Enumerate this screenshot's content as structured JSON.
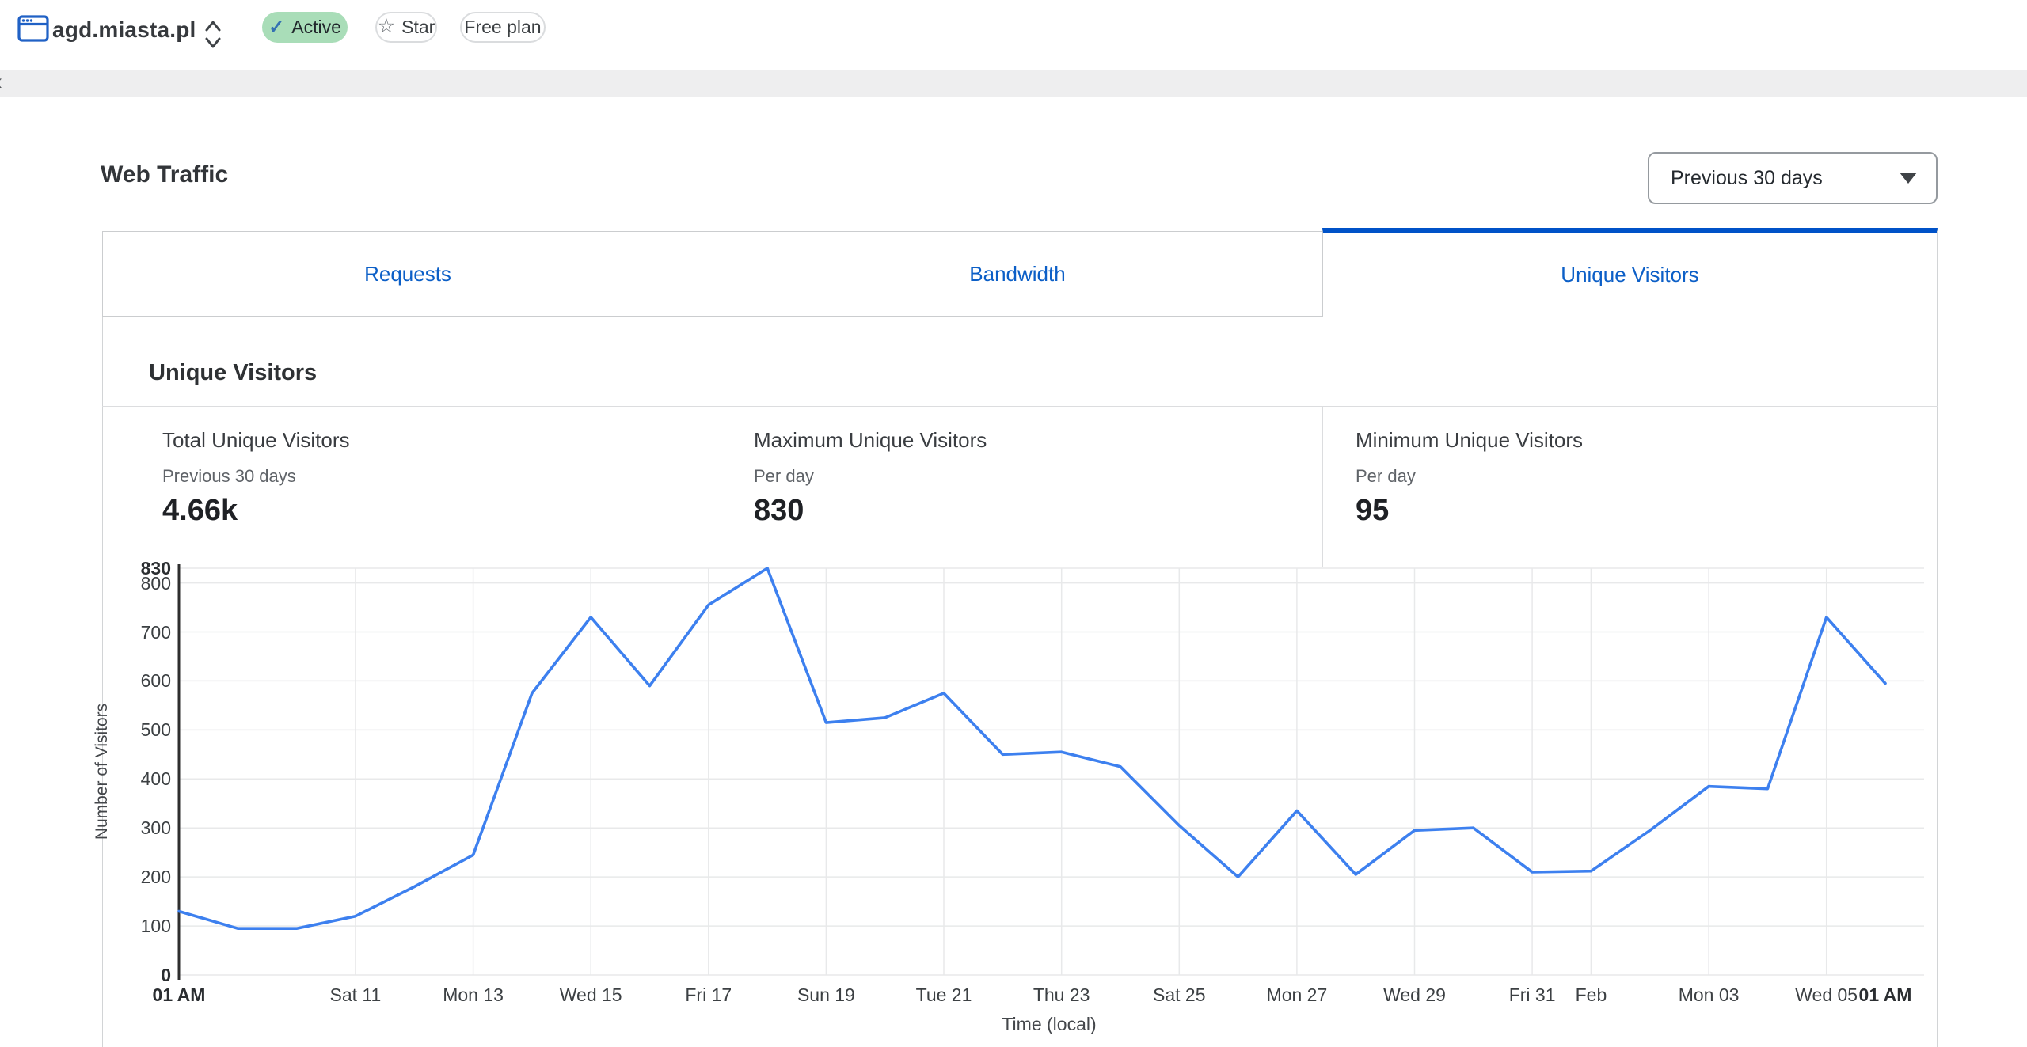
{
  "header": {
    "domain": "agd.miasta.pl",
    "badges": {
      "active": "Active",
      "star": "Star",
      "plan": "Free plan"
    }
  },
  "page": {
    "title": "Web Traffic"
  },
  "controls": {
    "time_range": {
      "value": "Previous 30 days"
    }
  },
  "tabs": {
    "items": [
      {
        "label": "Requests",
        "active": false
      },
      {
        "label": "Bandwidth",
        "active": false
      },
      {
        "label": "Unique Visitors",
        "active": true
      }
    ]
  },
  "section": {
    "title": "Unique Visitors",
    "stats": [
      {
        "title": "Total Unique Visitors",
        "subtitle": "Previous 30 days",
        "value": "4.66k"
      },
      {
        "title": "Maximum Unique Visitors",
        "subtitle": "Per day",
        "value": "830"
      },
      {
        "title": "Minimum Unique Visitors",
        "subtitle": "Per day",
        "value": "95"
      }
    ]
  },
  "colors": {
    "accent_blue": "#0052c8",
    "tab_link_blue": "#0c5fc7",
    "line_blue": "#3d80ef",
    "active_badge_green": "#a9ddb8",
    "gridline": "#e8e9ea"
  },
  "chart_data": {
    "type": "line",
    "title": "Unique Visitors",
    "xlabel": "Time (local)",
    "ylabel": "Number of Visitors",
    "ylim": [
      0,
      830
    ],
    "grid": true,
    "legend": "none",
    "values": [
      130,
      95,
      95,
      120,
      180,
      245,
      575,
      730,
      590,
      755,
      830,
      515,
      525,
      575,
      450,
      455,
      425,
      305,
      200,
      335,
      205,
      295,
      300,
      210,
      212,
      295,
      385,
      380,
      730,
      595
    ],
    "y_ticks": [
      {
        "v": 830,
        "bold": true
      },
      {
        "v": 800
      },
      {
        "v": 700
      },
      {
        "v": 600
      },
      {
        "v": 500
      },
      {
        "v": 400
      },
      {
        "v": 300
      },
      {
        "v": 200
      },
      {
        "v": 100
      },
      {
        "v": 0,
        "bold": true
      }
    ],
    "x_ticks": [
      {
        "i": 0,
        "label": "01 AM",
        "bold": true,
        "grid": false
      },
      {
        "i": 3,
        "label": "Sat 11"
      },
      {
        "i": 5,
        "label": "Mon 13"
      },
      {
        "i": 7,
        "label": "Wed 15"
      },
      {
        "i": 9,
        "label": "Fri 17"
      },
      {
        "i": 11,
        "label": "Sun 19"
      },
      {
        "i": 13,
        "label": "Tue 21"
      },
      {
        "i": 15,
        "label": "Thu 23"
      },
      {
        "i": 17,
        "label": "Sat 25"
      },
      {
        "i": 19,
        "label": "Mon 27"
      },
      {
        "i": 21,
        "label": "Wed 29"
      },
      {
        "i": 23,
        "label": "Fri 31"
      },
      {
        "i": 24,
        "label": "Feb"
      },
      {
        "i": 26,
        "label": "Mon 03"
      },
      {
        "i": 28,
        "label": "Wed 05"
      },
      {
        "i": 29,
        "label": "01 AM",
        "bold": true,
        "grid": false
      }
    ]
  }
}
